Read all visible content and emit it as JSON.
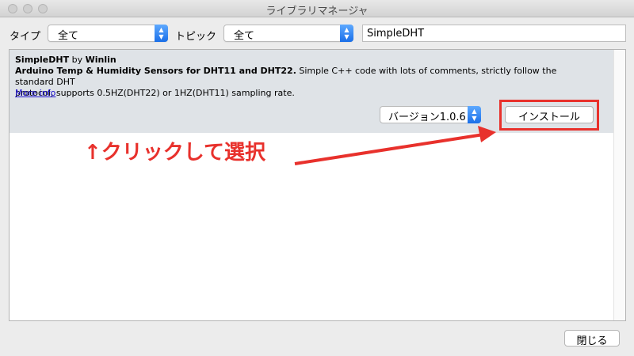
{
  "window": {
    "title": "ライブラリマネージャ"
  },
  "filters": {
    "type_label": "タイプ",
    "type_value": "全て",
    "topic_label": "トピック",
    "topic_value": "全て",
    "search_value": "SimpleDHT"
  },
  "library": {
    "name": "SimpleDHT",
    "by": "by",
    "author": "Winlin",
    "summary": "Arduino Temp & Humidity Sensors for DHT11 and DHT22.",
    "description_line1": " Simple C++ code with lots of comments, strictly follow the standard DHT",
    "description_line2": "protocol, supports 0.5HZ(DHT22) or 1HZ(DHT11) sampling rate.",
    "more_info": "More info",
    "version_value": "バージョン1.0.6",
    "install_label": "インストール"
  },
  "annotation": {
    "text": "↑クリックして選択",
    "color": "#e8312c"
  },
  "footer": {
    "close_label": "閉じる"
  }
}
